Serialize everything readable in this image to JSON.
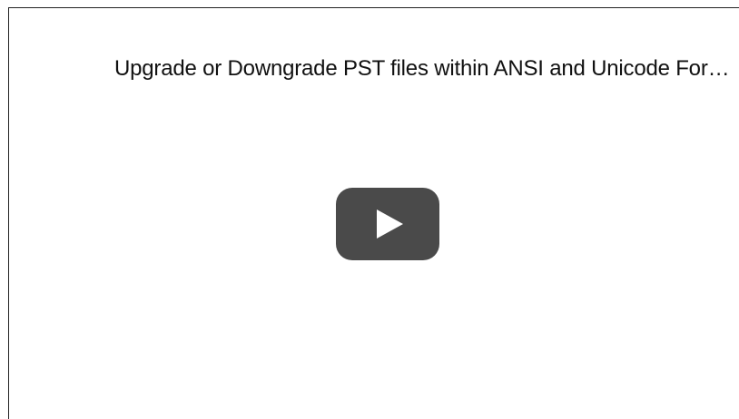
{
  "video": {
    "title": "Upgrade or Downgrade PST files within ANSI and Unicode Formats",
    "play_icon": "play-icon",
    "colors": {
      "play_button_bg": "#4a4a4a",
      "play_glyph": "#ffffff",
      "frame_border": "#222222",
      "title_text": "#111111"
    }
  }
}
